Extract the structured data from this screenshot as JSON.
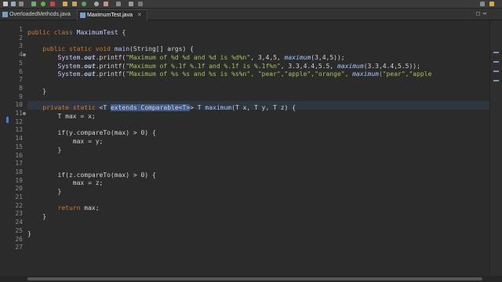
{
  "tabs": [
    {
      "label": "OverloadedMethods.java",
      "active": false
    },
    {
      "label": "MaximumTest.java",
      "active": true
    }
  ],
  "tab_close_glyph": "✕",
  "window_controls": "□ ▭",
  "colors": {
    "keyword": "#cc7832",
    "string": "#a5c25c",
    "number": "#6897bb",
    "selection": "#3f5a86",
    "background": "#2b2b2b"
  },
  "line_numbers": [
    "1",
    "2",
    "3",
    "4",
    "5",
    "6",
    "7",
    "8",
    "9",
    "10",
    "11",
    "12",
    "13",
    "14",
    "15",
    "16",
    "17",
    "18",
    "19",
    "20",
    "21",
    "22",
    "23",
    "24",
    "25",
    "26",
    "27"
  ],
  "code": {
    "l2": {
      "kw1": "public",
      "kw2": "class",
      "name": "MaximumTest",
      "rest": " {"
    },
    "l4": {
      "kw1": "public",
      "kw2": "static",
      "kw3": "void",
      "name": "main",
      "rest": "(String[] args) {"
    },
    "l5": {
      "pre": "System.",
      "out": "out",
      "printf": ".printf(",
      "s": "\"Maximum of %d %d and %d is %d%n\"",
      "args": ", 3,4,5, ",
      "call": "maximum",
      "tail": "(3,4,5));"
    },
    "l6": {
      "pre": "System.",
      "out": "out",
      "printf": ".printf(",
      "s": "\"Maximum of %.1f %.1f and %.1f is %.1f%n\"",
      "args": ", 3.3,4.4,5.5, ",
      "call": "maximum",
      "tail": "(3.3,4.4,5.5));"
    },
    "l7": {
      "pre": "System.",
      "out": "out",
      "printf": ".printf(",
      "s": "\"Maximum of %s %s and %s is %s%n\"",
      "args": ", \"pear\",\"apple\",\"orange\", ",
      "call": "maximum",
      "tail": "(\"pear\",\"apple"
    },
    "l9": {
      "text": "}"
    },
    "l11": {
      "kw1": "private",
      "kw2": "static",
      "pre": " <T ",
      "sel": "extends Comparable<T>",
      "post": "> T ",
      "name": "maximum",
      "rest": "(T x, T y, T z) {"
    },
    "l12": {
      "text": "T max = x;"
    },
    "l14": {
      "text": "if(y.compareTo(max) > 0) {"
    },
    "l15": {
      "text": "max = y;"
    },
    "l16": {
      "text": "}"
    },
    "l19": {
      "text": "if(z.compareTo(max) > 0) {"
    },
    "l20": {
      "text": "max = z;"
    },
    "l21": {
      "text": "}"
    },
    "l23": {
      "kw": "return",
      "rest": " max;"
    },
    "l24": {
      "text": "}"
    },
    "l26": {
      "text": "}"
    }
  }
}
